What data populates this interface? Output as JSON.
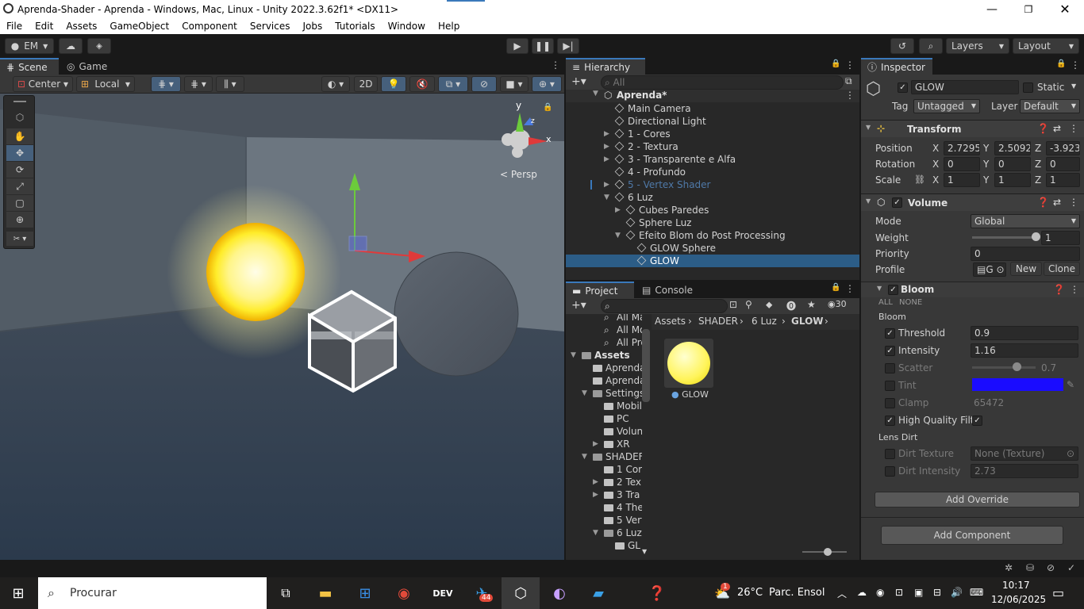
{
  "window": {
    "title": "Aprenda-Shader - Aprenda - Windows, Mac, Linux - Unity 2022.3.62f1* <DX11>"
  },
  "menu": [
    "File",
    "Edit",
    "Assets",
    "GameObject",
    "Component",
    "Services",
    "Jobs",
    "Tutorials",
    "Window",
    "Help"
  ],
  "toolbar": {
    "account": "EM",
    "layers": "Layers",
    "layout": "Layout"
  },
  "scene": {
    "tabs": {
      "scene": "Scene",
      "game": "Game"
    },
    "pivot": "Center",
    "space": "Local",
    "mode2d": "2D",
    "persp": "Persp",
    "gizmo_y": "y",
    "gizmo_x": "x",
    "gizmo_z": "z"
  },
  "hierarchy": {
    "tab": "Hierarchy",
    "search_placeholder": "All",
    "scene_name": "Aprenda*",
    "items": [
      {
        "label": "Main Camera",
        "indent": 1,
        "arrow": ""
      },
      {
        "label": "Directional Light",
        "indent": 1,
        "arrow": ""
      },
      {
        "label": "1 - Cores",
        "indent": 1,
        "arrow": "▶"
      },
      {
        "label": "2 - Textura",
        "indent": 1,
        "arrow": "▶"
      },
      {
        "label": "3 - Transparente e Alfa",
        "indent": 1,
        "arrow": "▶"
      },
      {
        "label": "4 - Profundo",
        "indent": 1,
        "arrow": ""
      },
      {
        "label": "5 - Vertex Shader",
        "indent": 1,
        "arrow": "▶",
        "disabled": true
      },
      {
        "label": "6 Luz",
        "indent": 1,
        "arrow": "▼"
      },
      {
        "label": "Cubes Paredes",
        "indent": 2,
        "arrow": "▶"
      },
      {
        "label": "Sphere Luz",
        "indent": 2,
        "arrow": ""
      },
      {
        "label": "Efeito Blom do Post Processing",
        "indent": 2,
        "arrow": "▼"
      },
      {
        "label": "GLOW Sphere",
        "indent": 3,
        "arrow": ""
      },
      {
        "label": "GLOW",
        "indent": 3,
        "arrow": "",
        "selected": true
      }
    ]
  },
  "project": {
    "tabs": {
      "project": "Project",
      "console": "Console"
    },
    "count": "30",
    "tree": [
      {
        "label": "All Mate",
        "indent": 2,
        "kind": "search"
      },
      {
        "label": "All Mode",
        "indent": 2,
        "kind": "search"
      },
      {
        "label": "All Prefa",
        "indent": 2,
        "kind": "search"
      },
      {
        "label": "Assets",
        "indent": 0,
        "kind": "folder-open",
        "arrow": "▼",
        "bold": true
      },
      {
        "label": "Aprenda",
        "indent": 1,
        "kind": "folder"
      },
      {
        "label": "Aprenda",
        "indent": 1,
        "kind": "folder"
      },
      {
        "label": "Settings",
        "indent": 1,
        "kind": "folder-open",
        "arrow": "▼"
      },
      {
        "label": "Mobil",
        "indent": 2,
        "kind": "folder"
      },
      {
        "label": "PC",
        "indent": 2,
        "kind": "folder"
      },
      {
        "label": "Volun",
        "indent": 2,
        "kind": "folder"
      },
      {
        "label": "XR",
        "indent": 2,
        "kind": "folder",
        "arrow": "▶"
      },
      {
        "label": "SHADEF",
        "indent": 1,
        "kind": "folder-open",
        "arrow": "▼"
      },
      {
        "label": "1 Cor",
        "indent": 2,
        "kind": "folder"
      },
      {
        "label": "2 Tex",
        "indent": 2,
        "kind": "folder",
        "arrow": "▶"
      },
      {
        "label": "3 Tra",
        "indent": 2,
        "kind": "folder",
        "arrow": "▶"
      },
      {
        "label": "4 The",
        "indent": 2,
        "kind": "folder"
      },
      {
        "label": "5 Vert",
        "indent": 2,
        "kind": "folder"
      },
      {
        "label": "6 Luz",
        "indent": 2,
        "kind": "folder-open",
        "arrow": "▼"
      },
      {
        "label": "GL",
        "indent": 3,
        "kind": "folder"
      }
    ],
    "breadcrumb": [
      "Assets",
      "SHADER",
      "6 Luz",
      "GLOW"
    ],
    "asset_label": "GLOW"
  },
  "inspector": {
    "tab": "Inspector",
    "object_name": "GLOW",
    "static_label": "Static",
    "tag_label": "Tag",
    "tag_value": "Untagged",
    "layer_label": "Layer",
    "layer_value": "Default",
    "transform": {
      "title": "Transform",
      "position_label": "Position",
      "rotation_label": "Rotation",
      "scale_label": "Scale",
      "pos": {
        "x": "2.7295",
        "y": "2.5092",
        "z": "-3.923"
      },
      "rot": {
        "x": "0",
        "y": "0",
        "z": "0"
      },
      "scale": {
        "x": "1",
        "y": "1",
        "z": "1"
      }
    },
    "volume": {
      "title": "Volume",
      "mode_label": "Mode",
      "mode_value": "Global",
      "weight_label": "Weight",
      "weight_value": "1",
      "weight_level": 1.0,
      "priority_label": "Priority",
      "priority_value": "0",
      "profile_label": "Profile",
      "profile_value": "G",
      "new_label": "New",
      "clone_label": "Clone"
    },
    "bloom": {
      "title": "Bloom",
      "all_label": "ALL",
      "none_label": "NONE",
      "section_label": "Bloom",
      "threshold_label": "Threshold",
      "threshold_value": "0.9",
      "intensity_label": "Intensity",
      "intensity_value": "1.16",
      "scatter_label": "Scatter",
      "scatter_value": "0.7",
      "scatter_level": 0.7,
      "tint_label": "Tint",
      "tint_color": "#1a0cff",
      "clamp_label": "Clamp",
      "clamp_value": "65472",
      "hq_label": "High Quality Filt",
      "lensdirt_label": "Lens Dirt",
      "dirt_texture_label": "Dirt Texture",
      "dirt_texture_value": "None (Texture)",
      "dirt_intensity_label": "Dirt Intensity",
      "dirt_intensity_value": "2.73"
    },
    "add_override": "Add Override",
    "add_component": "Add Component"
  },
  "taskbar": {
    "search_placeholder": "Procurar",
    "weather_temp": "26°C",
    "weather_desc": "Parc. Ensol",
    "time": "10:17",
    "date": "12/06/2025",
    "telegram_badge": "44",
    "weather_badge": "1"
  },
  "colors": {
    "accent": "#3a79bb",
    "selected_row": "#2c5d87",
    "tint": "#1a0cff",
    "gizmo_y": "#6ccb3b",
    "gizmo_x": "#e03a3a"
  }
}
